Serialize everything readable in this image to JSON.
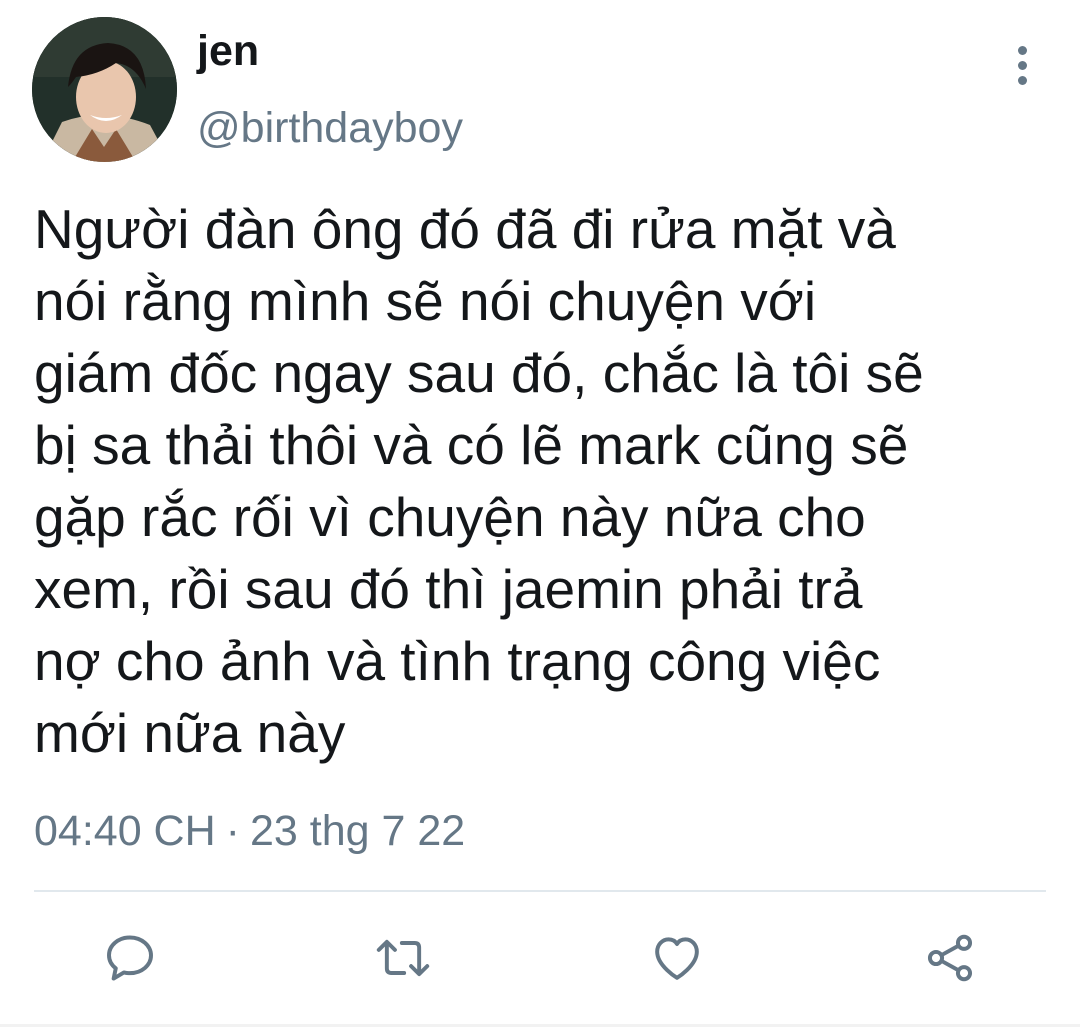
{
  "user": {
    "display_name": "jen",
    "handle": "@birthdayboy"
  },
  "tweet": {
    "text": "Người đàn ông đó đã đi rửa mặt và\nnói rằng mình sẽ nói chuyện với\ngiám đốc ngay sau đó, chắc là tôi sẽ\nbị sa thải thôi và có lẽ mark cũng sẽ\ngặp rắc rối vì chuyện này nữa cho\nxem, rồi sau đó thì jaemin phải trả\nnợ cho ảnh và tình trạng công việc\nmới nữa này",
    "time": "04:40 CH",
    "separator": "·",
    "date": "23 thg 7 22"
  },
  "icons": {
    "more": "more-vertical-icon",
    "reply": "reply-bubble-icon",
    "retweet": "retweet-icon",
    "like": "heart-icon",
    "share": "share-icon"
  },
  "colors": {
    "text_primary": "#14171a",
    "text_secondary": "#657786",
    "divider": "#e1e8ed"
  }
}
